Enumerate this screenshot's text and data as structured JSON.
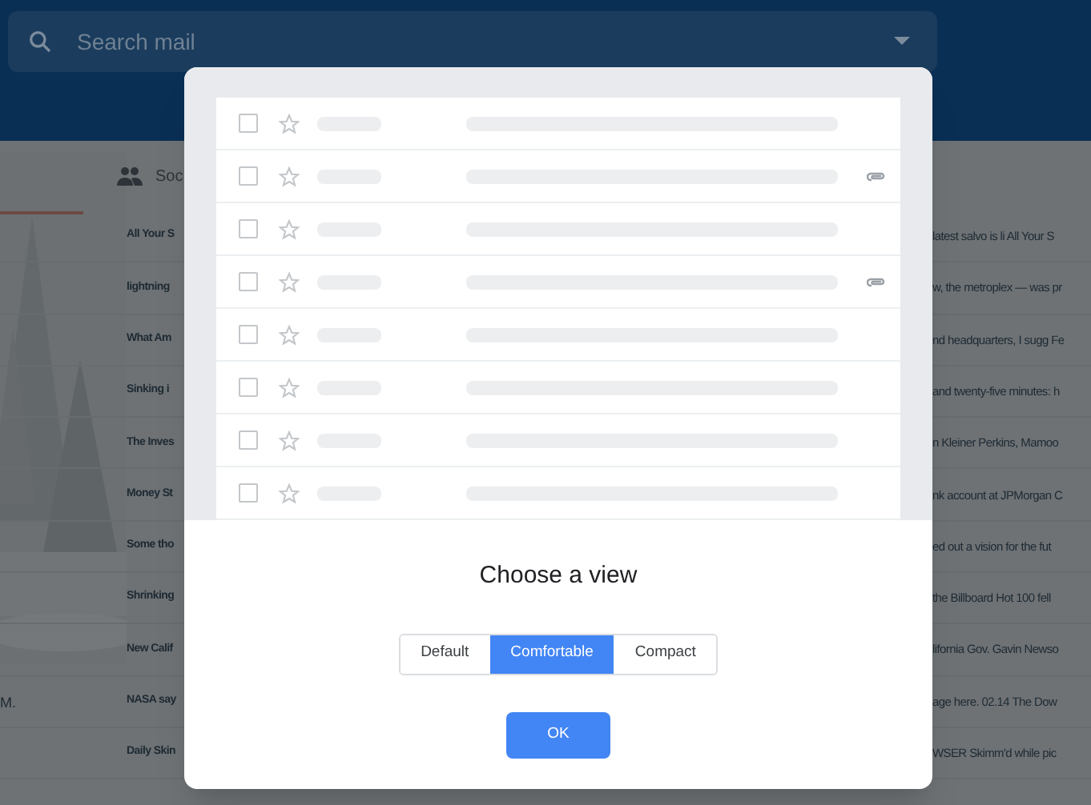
{
  "search": {
    "placeholder": "Search mail"
  },
  "category_tab": {
    "label": "Soc"
  },
  "emails": [
    {
      "subject": "All Your S",
      "snippet": "latest salvo is li All Your S"
    },
    {
      "subject": "lightning",
      "snippet": "w, the metroplex — was pr"
    },
    {
      "subject": "What Am",
      "snippet": "nd headquarters, I sugg Fe"
    },
    {
      "subject": "Sinking i",
      "snippet": "and twenty-five minutes: h"
    },
    {
      "subject": "The Inves",
      "snippet": "n Kleiner Perkins, Mamoo"
    },
    {
      "subject": "Money St",
      "snippet": "nk account at JPMorgan C"
    },
    {
      "subject": "Some tho",
      "snippet": "ed out a vision for the fut"
    },
    {
      "subject": "Shrinking",
      "snippet": "the Billboard Hot 100 fell"
    },
    {
      "subject": "New Calif",
      "snippet": "lifornia Gov. Gavin Newso"
    },
    {
      "sidebar_text": "M.",
      "subject": "NASA say",
      "snippet": "age here. 02.14 The Dow"
    },
    {
      "subject": "Daily Skin",
      "snippet": "WSER Skimm'd while pic"
    }
  ],
  "dialog": {
    "title": "Choose a view",
    "preview_rows": [
      {
        "checked": false,
        "attachment": false
      },
      {
        "checked": false,
        "attachment": true
      },
      {
        "checked": false,
        "attachment": false
      },
      {
        "checked": false,
        "attachment": true
      },
      {
        "checked": false,
        "attachment": false
      },
      {
        "checked": false,
        "attachment": false
      },
      {
        "checked": false,
        "attachment": false
      },
      {
        "checked": false,
        "attachment": false
      }
    ],
    "options": [
      {
        "label": "Default",
        "selected": false
      },
      {
        "label": "Comfortable",
        "selected": true
      },
      {
        "label": "Compact",
        "selected": false
      }
    ],
    "ok_button": "OK"
  }
}
